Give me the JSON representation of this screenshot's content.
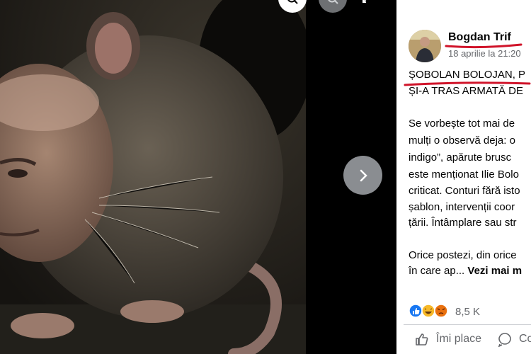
{
  "viewer": {
    "zoom_icon": "zoom-in-icon",
    "search_icon": "zoom-out-icon",
    "expand_icon": "expand-icon",
    "next_icon": "chevron-right-icon"
  },
  "post": {
    "author": "Bogdan Trif",
    "date": "18 aprilie la 21:20",
    "lines": [
      "ȘOBOLAN BOLOJAN, P",
      "ȘI-A TRAS ARMATĂ DE",
      "",
      "Se vorbește tot mai de",
      "mulți o observă deja: o",
      "indigo”, apărute brusc",
      "este menționat Ilie Bolo",
      "criticat. Conturi fără isto",
      "șablon, intervenții coor",
      "țării. Întâmplare sau str",
      "",
      "Orice postezi, din orice",
      "în care ap... "
    ],
    "see_more": "Vezi mai m",
    "reaction_count": "8,5 K",
    "reactions": [
      "like-icon",
      "haha-icon",
      "angry-icon"
    ],
    "actions": {
      "like": "Îmi place",
      "comment": "Co"
    }
  },
  "colors": {
    "annotation_red": "#d0142a",
    "fb_blue": "#1877f2",
    "panel_bg": "#ffffff"
  }
}
